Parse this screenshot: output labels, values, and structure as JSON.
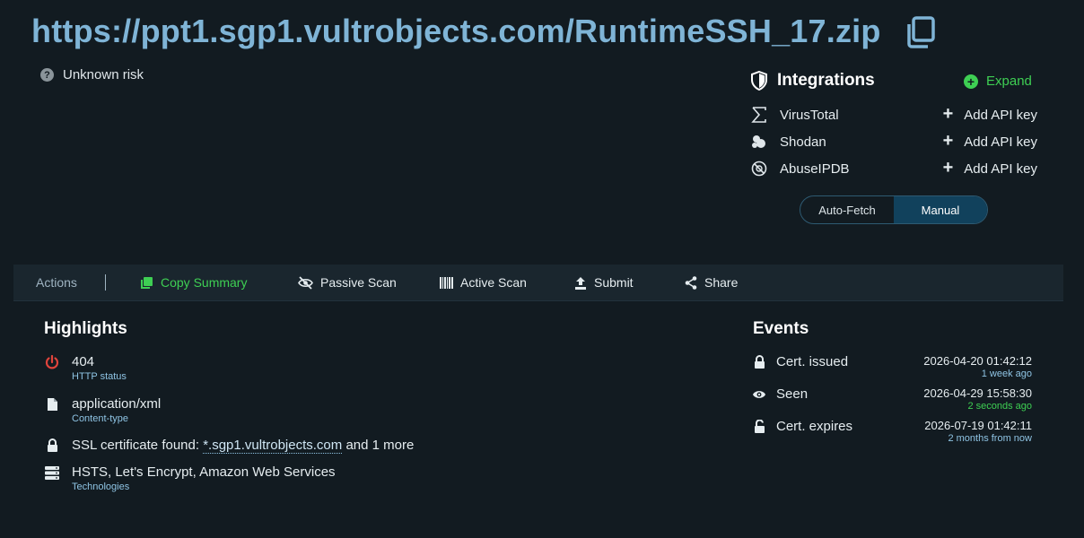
{
  "header": {
    "url": "https://ppt1.sgp1.vultrobjects.com/RuntimeSSH_17.zip",
    "copy_icon": "copy-icon"
  },
  "risk": {
    "label": "Unknown risk",
    "icon": "question-circle-icon"
  },
  "integrations": {
    "title": "Integrations",
    "expand_label": "Expand",
    "items": [
      {
        "name": "VirusTotal",
        "action": "Add API key",
        "icon": "sigma-icon"
      },
      {
        "name": "Shodan",
        "action": "Add API key",
        "icon": "shodan-icon"
      },
      {
        "name": "AbuseIPDB",
        "action": "Add API key",
        "icon": "abuseipdb-icon"
      }
    ],
    "mode": {
      "options": [
        "Auto-Fetch",
        "Manual"
      ],
      "selected": "Manual"
    }
  },
  "actions": {
    "label": "Actions",
    "items": [
      {
        "label": "Copy Summary",
        "icon": "copy-summary-icon"
      },
      {
        "label": "Passive Scan",
        "icon": "eye-slash-icon"
      },
      {
        "label": "Active Scan",
        "icon": "barcode-icon"
      },
      {
        "label": "Submit",
        "icon": "upload-icon"
      },
      {
        "label": "Share",
        "icon": "share-icon"
      }
    ]
  },
  "highlights": {
    "title": "Highlights",
    "http_status": {
      "value": "404",
      "label": "HTTP status"
    },
    "content_type": {
      "value": "application/xml",
      "label": "Content-type"
    },
    "ssl": {
      "prefix": "SSL certificate found:",
      "domain": "*.sgp1.vultrobjects.com",
      "suffix": "and 1 more"
    },
    "technologies": {
      "value": "HSTS, Let's Encrypt, Amazon Web Services",
      "label": "Technologies"
    }
  },
  "events": {
    "title": "Events",
    "items": [
      {
        "name": "Cert. issued",
        "date": "2026-04-20 01:42:12",
        "relative": "1 week ago"
      },
      {
        "name": "Seen",
        "date": "2026-04-29 15:58:30",
        "relative": "2 seconds ago"
      },
      {
        "name": "Cert. expires",
        "date": "2026-07-19 01:42:11",
        "relative": "2 months from now"
      }
    ]
  },
  "colors": {
    "background": "#121b21",
    "url": "#7fb4d6",
    "accent_green": "#3ecf53",
    "status_red": "#e0443c",
    "sublabel": "#8fc4e4"
  }
}
